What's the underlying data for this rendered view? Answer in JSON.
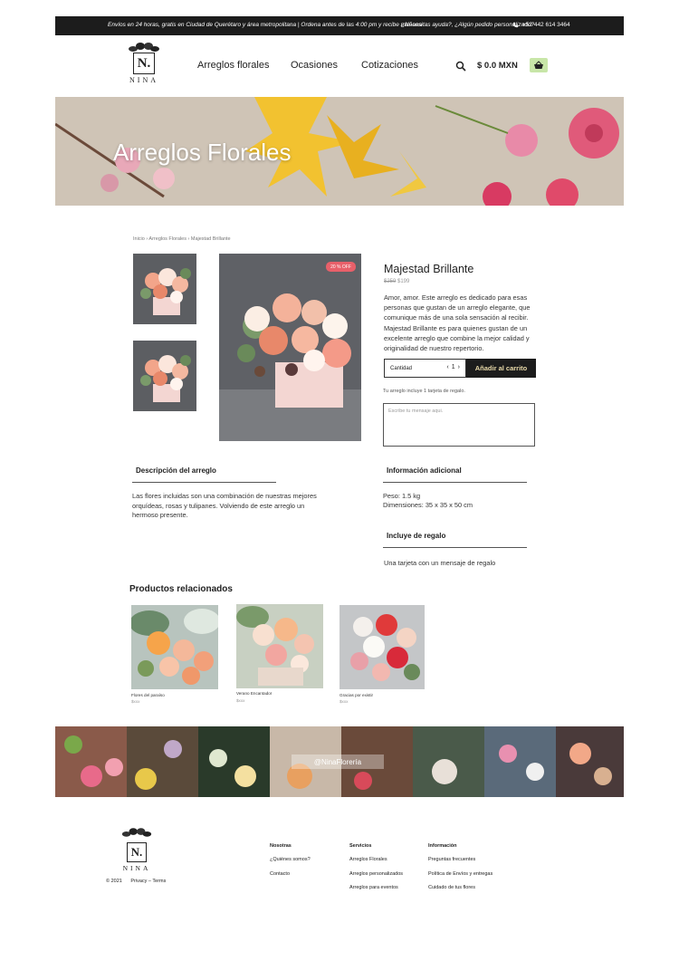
{
  "topbar": {
    "shipping": "Envíos en 24 horas, gratis en Ciudad de Querétaro y área metropolitana  |  Ordena antes de las 4:00 pm y recibe mañana",
    "help": "¿Necesitas ayuda?, ¿Algún pedido personalizado?",
    "phone": "+52 442 614 3464",
    "phone_icon": "phone-icon"
  },
  "header": {
    "logo_letter": "N.",
    "logo_word": "NINA",
    "nav": [
      "Arreglos florales",
      "Ocasiones",
      "Cotizaciones"
    ],
    "cart_total": "$ 0.0 MXN",
    "search_icon": "search-icon",
    "cart_icon": "basket-icon",
    "cart_color": "#c8e6a8"
  },
  "hero": {
    "title": "Arreglos Florales"
  },
  "breadcrumb": "Inicio › Arreglos Florales › Majestad Brillante",
  "product": {
    "badge": "20 % OFF",
    "title": "Majestad Brillante",
    "price_old": "$259",
    "price_new": "$199",
    "description": "Amor, amor. Este arreglo es dedicado para esas personas que gustan de un arreglo elegante, que comunique más de una sola sensación al recibir. Majestad Brillante es para quienes gustan de un excelente arreglo que combine la mejor calidad y originalidad de nuestro repertorio.",
    "qty_label": "Cantidad",
    "qty_value": "1",
    "add_to_cart": "Añadir al carrito",
    "gift_note": "Tu arreglo incluye 1 tarjeta de regalo.",
    "message_placeholder": "Escribe tu mensaje aqui."
  },
  "sections": {
    "desc_title": "Descripción del arreglo",
    "desc_text": "Las flores incluidas son una combinación de nuestras mejores orquídeas, rosas y tulipanes. Volviendo de este arreglo un hermoso presente.",
    "info_title": "Información adicional",
    "info_weight": "Peso: 1.5 kg",
    "info_dims": "Dimensiones: 35 x 35 x 50 cm",
    "gift_title": "Incluye de regalo",
    "gift_text": "Una tarjeta con un mensaje de regalo"
  },
  "related": {
    "title": "Productos relacionados",
    "items": [
      {
        "name": "Flores del paraíso",
        "price": "$xxx"
      },
      {
        "name": "Verano Encantador",
        "price": "$xxx"
      },
      {
        "name": "Gracias por existir",
        "price": "$xxx"
      }
    ]
  },
  "instagram": {
    "label": "@NinaFlorería"
  },
  "footer": {
    "copyright": "© 2021",
    "privacy_terms": "Privacy – Terms",
    "columns": [
      {
        "title": "Nosotras",
        "links": [
          "¿Quiénes somos?",
          "Contacto"
        ]
      },
      {
        "title": "Servicios",
        "links": [
          "Arreglos Florales",
          "Arreglos personalizados",
          "Arreglos para eventos"
        ]
      },
      {
        "title": "Información",
        "links": [
          "Preguntas frecuentes",
          "Política de Envíos y entregas",
          "Cuidado de tus flores"
        ]
      }
    ]
  }
}
